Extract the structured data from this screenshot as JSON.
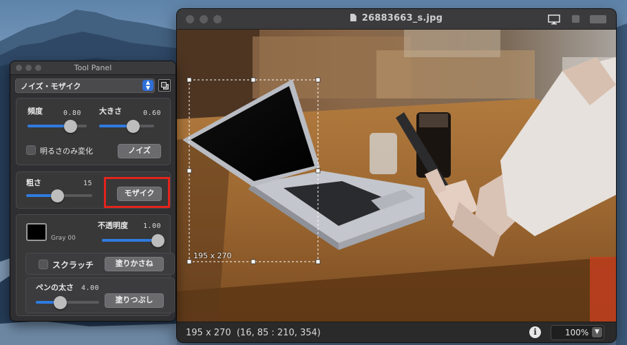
{
  "image_window": {
    "filename": "26883663_s.jpg",
    "selection_label": "195 x 270",
    "status_text": "195 x 270  (16, 85 : 210, 354)",
    "zoom": "100%"
  },
  "tool_panel": {
    "title": "Tool Panel",
    "mode_select": "ノイズ・モザイク",
    "noise": {
      "frequency_label": "頻度",
      "frequency_value": "0.80",
      "frequency_level": 0.8,
      "size_label": "大きさ",
      "size_value": "0.60",
      "size_level": 0.6,
      "brightness_only_label": "明るさのみ変化",
      "noise_button": "ノイズ"
    },
    "mosaic": {
      "coarseness_label": "粗さ",
      "coarseness_value": "15",
      "mosaic_button": "モザイク"
    },
    "fill": {
      "color_name": "Gray 00",
      "opacity_label": "不透明度",
      "opacity_value": "1.00",
      "scratch_label": "スクラッチ",
      "overlay_button": "塗りかさね",
      "pen_width_label": "ペンの太さ",
      "pen_width_value": "4.00",
      "fill_button": "塗りつぶし"
    }
  },
  "colors": {
    "accent": "#2f7be0",
    "highlight": "#e3231c"
  }
}
